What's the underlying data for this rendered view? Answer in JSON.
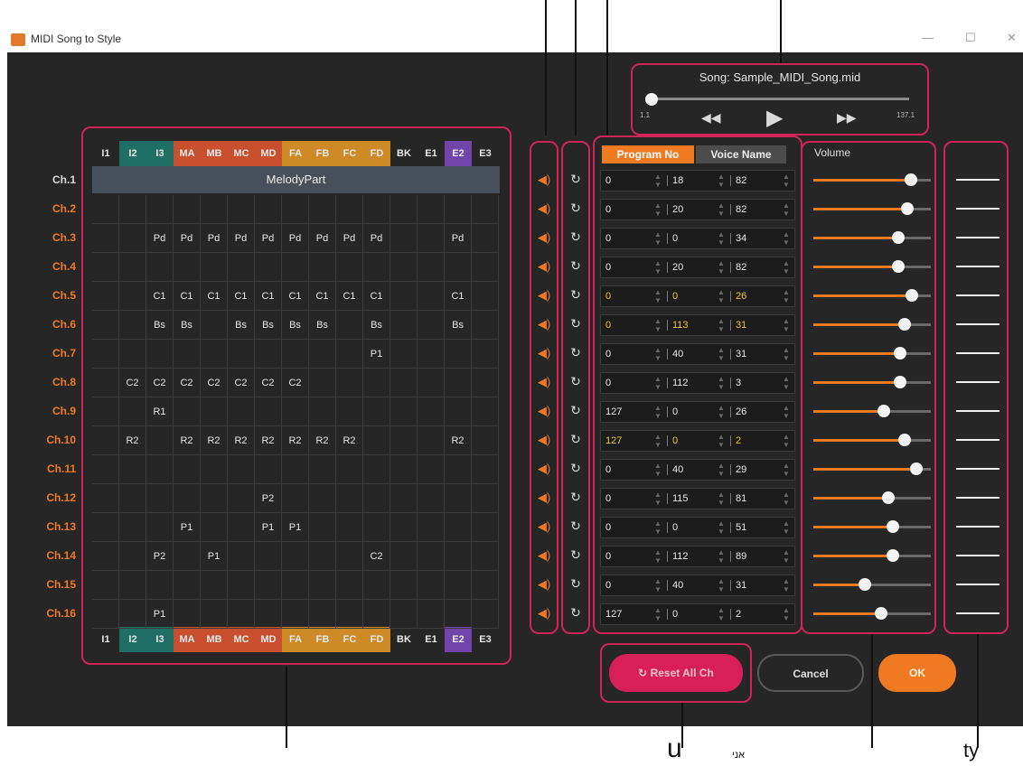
{
  "window": {
    "title": "MIDI Song to Style",
    "minimize": "—",
    "maximize": "☐",
    "close": "✕"
  },
  "song": {
    "title": "Song: Sample_MIDI_Song.mid",
    "start": "1.1",
    "end": "137.1",
    "position": 0.0
  },
  "parts": [
    {
      "label": "I1",
      "color": "#262626"
    },
    {
      "label": "I2",
      "color": "#1f6f66"
    },
    {
      "label": "I3",
      "color": "#1f6f66"
    },
    {
      "label": "MA",
      "color": "#c8502f"
    },
    {
      "label": "MB",
      "color": "#c8502f"
    },
    {
      "label": "MC",
      "color": "#c8502f"
    },
    {
      "label": "MD",
      "color": "#c8502f"
    },
    {
      "label": "FA",
      "color": "#cf8a28"
    },
    {
      "label": "FB",
      "color": "#cf8a28"
    },
    {
      "label": "FC",
      "color": "#cf8a28"
    },
    {
      "label": "FD",
      "color": "#cf8a28"
    },
    {
      "label": "BK",
      "color": "#262626"
    },
    {
      "label": "E1",
      "color": "#262626"
    },
    {
      "label": "E2",
      "color": "#7044a8"
    },
    {
      "label": "E3",
      "color": "#262626"
    }
  ],
  "melody_part_label": "MelodyPart",
  "channels": [
    {
      "label": "Ch.1",
      "label_color": "#d8d8d8",
      "cells": [],
      "program": "0",
      "msb": "18",
      "lsb": "82",
      "highlight": false,
      "volume": 0.83
    },
    {
      "label": "Ch.2",
      "label_color": "#f07a22",
      "cells": [
        "",
        "",
        "",
        "",
        "",
        "",
        "",
        "",
        "",
        "",
        "",
        "",
        "",
        "",
        ""
      ],
      "program": "0",
      "msb": "20",
      "lsb": "82",
      "highlight": false,
      "volume": 0.8
    },
    {
      "label": "Ch.3",
      "label_color": "#f07a22",
      "cells": [
        "",
        "",
        "Pd",
        "Pd",
        "Pd",
        "Pd",
        "Pd",
        "Pd",
        "Pd",
        "Pd",
        "Pd",
        "",
        "",
        "Pd",
        ""
      ],
      "program": "0",
      "msb": "0",
      "lsb": "34",
      "highlight": false,
      "volume": 0.72
    },
    {
      "label": "Ch.4",
      "label_color": "#f07a22",
      "cells": [
        "",
        "",
        "",
        "",
        "",
        "",
        "",
        "",
        "",
        "",
        "",
        "",
        "",
        "",
        ""
      ],
      "program": "0",
      "msb": "20",
      "lsb": "82",
      "highlight": false,
      "volume": 0.72
    },
    {
      "label": "Ch.5",
      "label_color": "#f07a22",
      "cells": [
        "",
        "",
        "C1",
        "C1",
        "C1",
        "C1",
        "C1",
        "C1",
        "C1",
        "C1",
        "C1",
        "",
        "",
        "C1",
        ""
      ],
      "program": "0",
      "msb": "0",
      "lsb": "26",
      "highlight": true,
      "volume": 0.84
    },
    {
      "label": "Ch.6",
      "label_color": "#f07a22",
      "cells": [
        "",
        "",
        "Bs",
        "Bs",
        "",
        "Bs",
        "Bs",
        "Bs",
        "Bs",
        "",
        "Bs",
        "",
        "",
        "Bs",
        ""
      ],
      "program": "0",
      "msb": "113",
      "lsb": "31",
      "highlight": true,
      "volume": 0.78
    },
    {
      "label": "Ch.7",
      "label_color": "#f07a22",
      "cells": [
        "",
        "",
        "",
        "",
        "",
        "",
        "",
        "",
        "",
        "",
        "P1",
        "",
        "",
        "",
        ""
      ],
      "program": "0",
      "msb": "40",
      "lsb": "31",
      "highlight": false,
      "volume": 0.74
    },
    {
      "label": "Ch.8",
      "label_color": "#f07a22",
      "cells": [
        "",
        "C2",
        "C2",
        "C2",
        "C2",
        "C2",
        "C2",
        "C2",
        "",
        "",
        "",
        "",
        "",
        "",
        ""
      ],
      "program": "0",
      "msb": "112",
      "lsb": "3",
      "highlight": false,
      "volume": 0.74
    },
    {
      "label": "Ch.9",
      "label_color": "#f07a22",
      "cells": [
        "",
        "",
        "R1",
        "",
        "",
        "",
        "",
        "",
        "",
        "",
        "",
        "",
        "",
        "",
        ""
      ],
      "program": "127",
      "msb": "0",
      "lsb": "26",
      "highlight": false,
      "volume": 0.6
    },
    {
      "label": "Ch.10",
      "label_color": "#f07a22",
      "cells": [
        "",
        "R2",
        "",
        "R2",
        "R2",
        "R2",
        "R2",
        "R2",
        "R2",
        "R2",
        "",
        "",
        "",
        "R2",
        ""
      ],
      "program": "127",
      "msb": "0",
      "lsb": "2",
      "highlight": true,
      "volume": 0.78
    },
    {
      "label": "Ch.11",
      "label_color": "#f07a22",
      "cells": [
        "",
        "",
        "",
        "",
        "",
        "",
        "",
        "",
        "",
        "",
        "",
        "",
        "",
        "",
        ""
      ],
      "program": "0",
      "msb": "40",
      "lsb": "29",
      "highlight": false,
      "volume": 0.88
    },
    {
      "label": "Ch.12",
      "label_color": "#f07a22",
      "cells": [
        "",
        "",
        "",
        "",
        "",
        "",
        "P2",
        "",
        "",
        "",
        "",
        "",
        "",
        "",
        ""
      ],
      "program": "0",
      "msb": "115",
      "lsb": "81",
      "highlight": false,
      "volume": 0.64
    },
    {
      "label": "Ch.13",
      "label_color": "#f07a22",
      "cells": [
        "",
        "",
        "",
        "P1",
        "",
        "",
        "P1",
        "P1",
        "",
        "",
        "",
        "",
        "",
        "",
        ""
      ],
      "program": "0",
      "msb": "0",
      "lsb": "51",
      "highlight": false,
      "volume": 0.68
    },
    {
      "label": "Ch.14",
      "label_color": "#f07a22",
      "cells": [
        "",
        "",
        "P2",
        "",
        "P1",
        "",
        "",
        "",
        "",
        "",
        "C2",
        "",
        "",
        "",
        ""
      ],
      "program": "0",
      "msb": "112",
      "lsb": "89",
      "highlight": false,
      "volume": 0.68
    },
    {
      "label": "Ch.15",
      "label_color": "#f07a22",
      "cells": [
        "",
        "",
        "",
        "",
        "",
        "",
        "",
        "",
        "",
        "",
        "",
        "",
        "",
        "",
        ""
      ],
      "program": "0",
      "msb": "40",
      "lsb": "31",
      "highlight": false,
      "volume": 0.44
    },
    {
      "label": "Ch.16",
      "label_color": "#f07a22",
      "cells": [
        "",
        "",
        "P1",
        "",
        "",
        "",
        "",
        "",
        "",
        "",
        "",
        "",
        "",
        "",
        ""
      ],
      "program": "127",
      "msb": "0",
      "lsb": "2",
      "highlight": false,
      "volume": 0.58
    }
  ],
  "tabs": {
    "program_no": "Program No",
    "voice_name": "Voice Name"
  },
  "volume_label": "Volume",
  "buttons": {
    "reset_all": "Reset All Ch",
    "cancel": "Cancel",
    "ok": "OK"
  },
  "icons": {
    "speaker": "speaker-icon",
    "reset": "reset-icon",
    "rewind": "rewind-icon",
    "play": "play-icon",
    "forward": "fast-forward-icon"
  },
  "colors": {
    "accent": "#f07a22",
    "callout": "#d0245a",
    "highlight_text": "#e8c830",
    "background": "#262626"
  },
  "bottom_labels": {
    "u": "u",
    "ani": "אני",
    "ty": "ty"
  }
}
